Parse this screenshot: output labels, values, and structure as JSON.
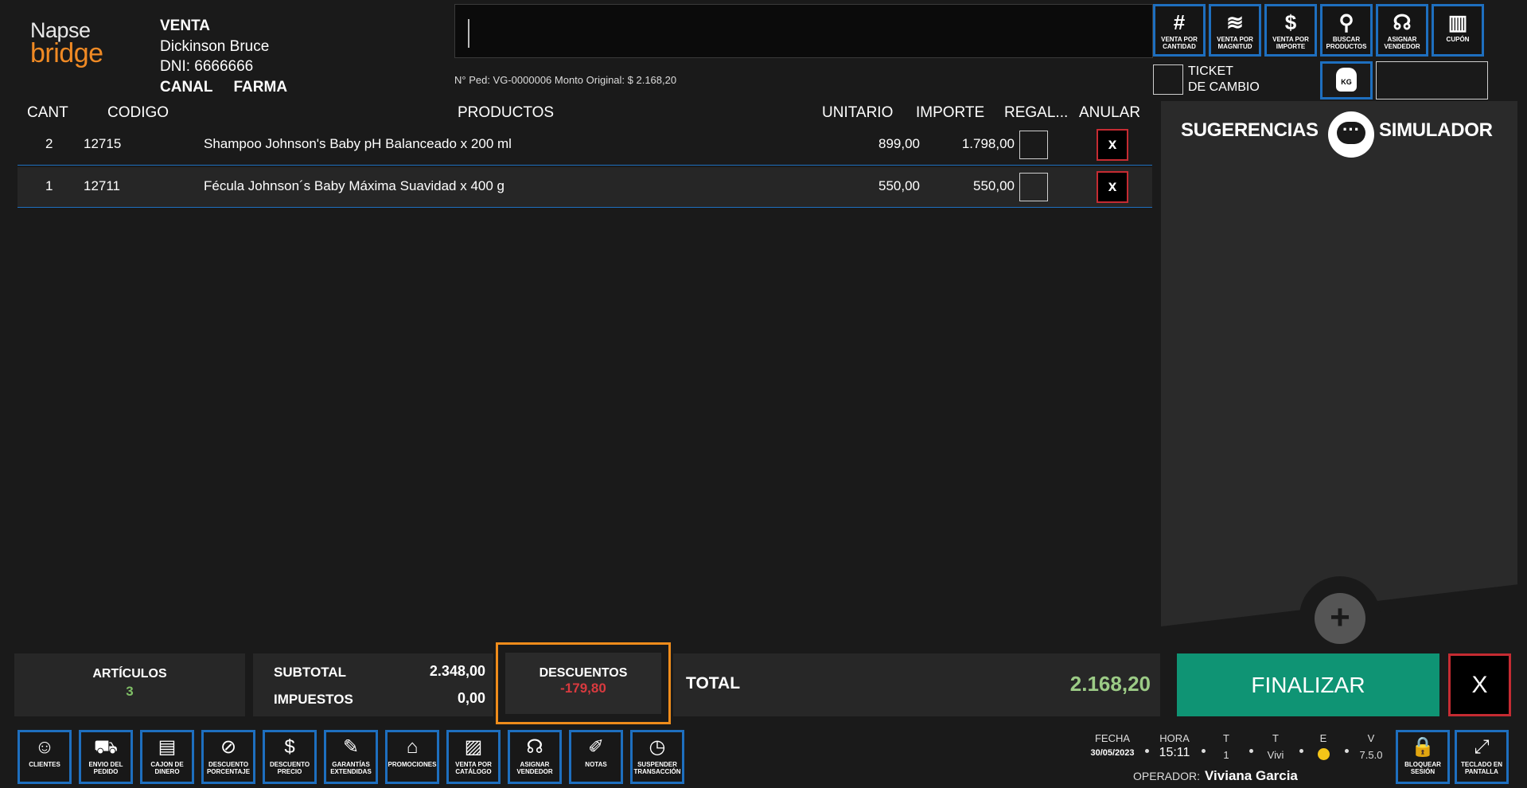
{
  "logo": {
    "line1": "Napse",
    "line2": "bridge"
  },
  "customer": {
    "mode": "VENTA",
    "name": "Dickinson Bruce",
    "dni": "DNI: 6666666",
    "canal": "CANAL",
    "farma": "FARMA"
  },
  "order_info": "N° Ped: VG-0000006  Monto Original: $ 2.168,20",
  "top_buttons": [
    {
      "icon": "#",
      "label1": "VENTA POR",
      "label2": "CANTIDAD"
    },
    {
      "icon": "≋",
      "label1": "VENTA POR",
      "label2": "MAGNITUD"
    },
    {
      "icon": "$",
      "label1": "VENTA POR",
      "label2": "IMPORTE"
    },
    {
      "icon": "⚲",
      "label1": "BUSCAR",
      "label2": "PRODUCTOS"
    },
    {
      "icon": "☊",
      "label1": "ASIGNAR",
      "label2": "VENDEDOR"
    },
    {
      "icon": "▥",
      "label1": "CUPÓN",
      "label2": ""
    }
  ],
  "ticket": {
    "line1": "TICKET",
    "line2": "DE CAMBIO"
  },
  "kg_label": "KG",
  "columns": {
    "cant": "CANT",
    "codigo": "CODIGO",
    "productos": "PRODUCTOS",
    "unitario": "UNITARIO",
    "importe": "IMPORTE",
    "regalo": "REGAL...",
    "anular": "ANULAR"
  },
  "items": [
    {
      "cant": "2",
      "codigo": "12715",
      "producto": "Shampoo Johnson's Baby pH Balanceado x 200 ml",
      "unitario": "899,00",
      "importe": "1.798,00",
      "anular": "x"
    },
    {
      "cant": "1",
      "codigo": "12711",
      "producto": "Fécula Johnson´s Baby Máxima Suavidad x 400 g",
      "unitario": "550,00",
      "importe": "550,00",
      "anular": "x"
    }
  ],
  "side_panel": {
    "left": "SUGERENCIAS",
    "right": "SIMULADOR",
    "bubble": "···",
    "plus": "+"
  },
  "summary": {
    "articulos_label": "ARTÍCULOS",
    "articulos_value": "3",
    "subtotal_label": "SUBTOTAL",
    "subtotal_value": "2.348,00",
    "impuestos_label": "IMPUESTOS",
    "impuestos_value": "0,00",
    "descuentos_label": "DESCUENTOS",
    "descuentos_value": "-179,80",
    "total_label": "TOTAL",
    "total_value": "2.168,20"
  },
  "actions": {
    "finalizar": "FINALIZAR",
    "cancel": "X"
  },
  "bottom_buttons": [
    {
      "icon": "☺",
      "label1": "CLIENTES",
      "label2": ""
    },
    {
      "icon": "⛟",
      "label1": "ENVIO DEL",
      "label2": "PEDIDO"
    },
    {
      "icon": "▤",
      "label1": "CAJON DE",
      "label2": "DINERO"
    },
    {
      "icon": "⊘",
      "label1": "DESCUENTO",
      "label2": "PORCENTAJE"
    },
    {
      "icon": "$",
      "label1": "DESCUENTO",
      "label2": "PRECIO"
    },
    {
      "icon": "✎",
      "label1": "GARANTÍAS",
      "label2": "EXTENDIDAS"
    },
    {
      "icon": "⌂",
      "label1": "PROMOCIONES",
      "label2": ""
    },
    {
      "icon": "▨",
      "label1": "VENTA POR",
      "label2": "CATÁLOGO"
    },
    {
      "icon": "☊",
      "label1": "ASIGNAR",
      "label2": "VENDEDOR"
    },
    {
      "icon": "✐",
      "label1": "NOTAS",
      "label2": ""
    },
    {
      "icon": "◷",
      "label1": "SUSPENDER",
      "label2": "TRANSACCIÓN"
    }
  ],
  "status": {
    "fecha_label": "FECHA",
    "fecha_value": "30/05/2023",
    "hora_label": "HORA",
    "hora_value": "15:11",
    "t1_label": "T",
    "t1_value": "1",
    "t2_label": "T",
    "t2_value": "Vivi",
    "e_label": "E",
    "v_label": "V",
    "v_value": "7.5.0",
    "operador_label": "OPERADOR:",
    "operador_value": "Viviana Garcia"
  },
  "right_buttons": [
    {
      "icon": "🔒",
      "label1": "BLOQUEAR",
      "label2": "SESIÓN"
    },
    {
      "icon": "⤢",
      "label1": "TECLADO EN",
      "label2": "PANTALLA"
    }
  ],
  "colors": {
    "accent_blue": "#1e6fbf",
    "finalizar_green": "#0f9474",
    "discount_red": "#d93a3f",
    "total_green": "#9ccb86",
    "highlight_orange": "#ef8c1b",
    "brand_orange": "#f08a24"
  }
}
